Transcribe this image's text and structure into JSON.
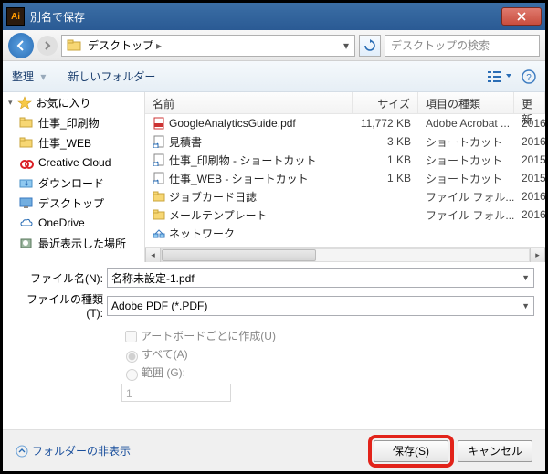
{
  "window": {
    "title": "別名で保存"
  },
  "nav": {
    "location": "デスクトップ",
    "search_placeholder": "デスクトップの検索"
  },
  "toolbar": {
    "organize": "整理",
    "new_folder": "新しいフォルダー"
  },
  "sidebar": {
    "favorites": "お気に入り",
    "items": [
      "仕事_印刷物",
      "仕事_WEB",
      "Creative Cloud ",
      "ダウンロード",
      "デスクトップ",
      "OneDrive",
      "最近表示した場所"
    ]
  },
  "columns": {
    "name": "名前",
    "size": "サイズ",
    "type": "項目の種類",
    "date": "更新"
  },
  "files": [
    {
      "name": "GoogleAnalyticsGuide.pdf",
      "size": "11,772 KB",
      "type": "Adobe Acrobat ...",
      "date": "2016"
    },
    {
      "name": "見積書",
      "size": "3 KB",
      "type": "ショートカット",
      "date": "2016"
    },
    {
      "name": "仕事_印刷物 - ショートカット",
      "size": "1 KB",
      "type": "ショートカット",
      "date": "2015"
    },
    {
      "name": "仕事_WEB - ショートカット",
      "size": "1 KB",
      "type": "ショートカット",
      "date": "2015"
    },
    {
      "name": "ジョブカード日誌",
      "size": "",
      "type": "ファイル フォル...",
      "date": "2016"
    },
    {
      "name": "メールテンプレート",
      "size": "",
      "type": "ファイル フォル...",
      "date": "2016"
    },
    {
      "name": "ネットワーク",
      "size": "",
      "type": "",
      "date": ""
    }
  ],
  "form": {
    "filename_label": "ファイル名(N):",
    "filename_value": "名称未設定-1.pdf",
    "filetype_label": "ファイルの種類(T):",
    "filetype_value": "Adobe PDF (*.PDF)"
  },
  "options": {
    "per_artboard": "アートボードごとに作成(U)",
    "all": "すべて(A)",
    "range": "範囲 (G):",
    "range_value": "1"
  },
  "footer": {
    "hide_folders": "フォルダーの非表示",
    "save": "保存(S)",
    "cancel": "キャンセル"
  }
}
